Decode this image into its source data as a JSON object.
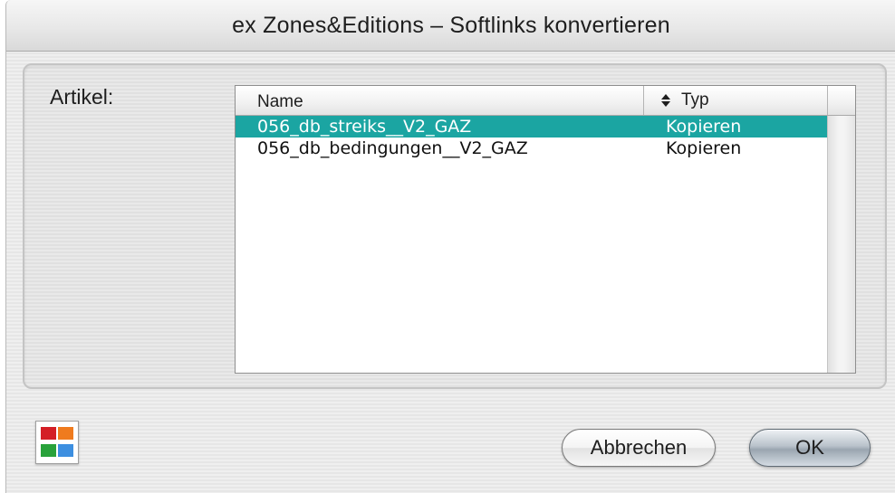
{
  "window": {
    "title": "ex Zones&Editions – Softlinks konvertieren"
  },
  "form": {
    "artikel_label": "Artikel:"
  },
  "list": {
    "columns": {
      "name": "Name",
      "typ": "Typ"
    },
    "rows": [
      {
        "name": "056_db_streiks__V2_GAZ",
        "typ": "Kopieren",
        "selected": true
      },
      {
        "name": "056_db_bedingungen__V2_GAZ",
        "typ": "Kopieren",
        "selected": false
      }
    ],
    "selection_color": "#1ba5a2"
  },
  "footer": {
    "app_icon": "four-color-grid-icon",
    "cancel_label": "Abbrechen",
    "ok_label": "OK"
  }
}
